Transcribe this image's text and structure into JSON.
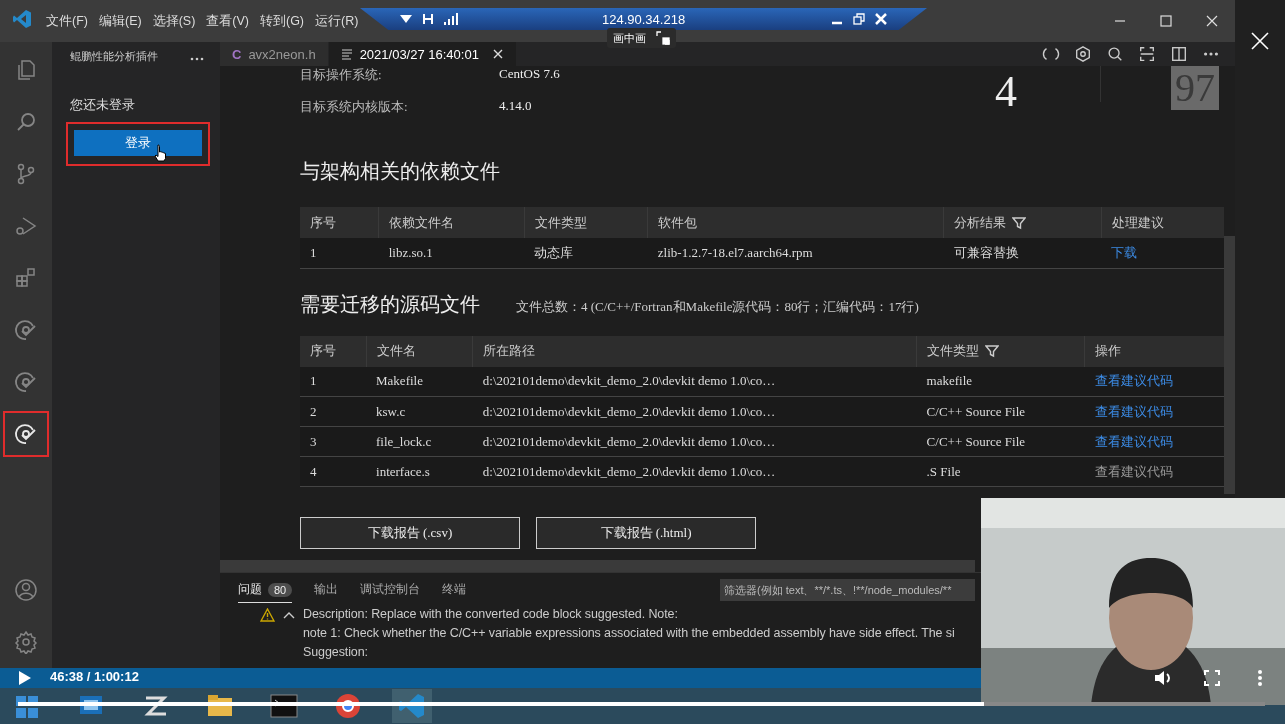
{
  "title_bar": {
    "menu": [
      "文件(F)",
      "编辑(E)",
      "选择(S)",
      "查看(V)",
      "转到(G)",
      "运行(R)"
    ]
  },
  "remote_bar": {
    "address": "124.90.34.218",
    "tooltip": "画中画"
  },
  "activity_bar": {
    "items": [
      {
        "kind": "files",
        "selected": false
      },
      {
        "kind": "search",
        "selected": false
      },
      {
        "kind": "source-control",
        "selected": false
      },
      {
        "kind": "run",
        "selected": false
      },
      {
        "kind": "extensions",
        "selected": false
      },
      {
        "kind": "plugin",
        "selected": false
      },
      {
        "kind": "plugin",
        "selected": false
      },
      {
        "kind": "plugin",
        "selected": true
      }
    ],
    "bottom": [
      {
        "kind": "account"
      },
      {
        "kind": "settings"
      }
    ]
  },
  "sidebar": {
    "title": "鲲鹏性能分析插件",
    "message": "您还未登录",
    "login_button": "登录"
  },
  "tabs": [
    {
      "label": "avx2neon.h",
      "badge": "C",
      "kind": "c-file",
      "selected": false
    },
    {
      "label": "2021/03/27 16:40:01",
      "kind": "preview",
      "selected": true
    }
  ],
  "report": {
    "info": [
      {
        "label": "目标操作系统:",
        "value": "CentOS 7.6"
      },
      {
        "label": "目标系统内核版本:",
        "value": "4.14.0"
      }
    ],
    "stats": [
      {
        "value": "4",
        "kind": "plain"
      },
      {
        "value": "97",
        "kind": "boxed"
      }
    ],
    "dependencies": {
      "heading": "与架构相关的依赖文件",
      "columns": [
        {
          "label": "序号",
          "filter": false
        },
        {
          "label": "依赖文件名",
          "filter": false
        },
        {
          "label": "文件类型",
          "filter": false
        },
        {
          "label": "软件包",
          "filter": false
        },
        {
          "label": "分析结果",
          "filter": true
        },
        {
          "label": "处理建议",
          "filter": false
        }
      ],
      "rows": [
        {
          "cells": [
            "1",
            "libz.so.1",
            "动态库",
            "zlib-1.2.7-18.el7.aarch64.rpm",
            "可兼容替换"
          ],
          "action": {
            "label": "下载",
            "disabled": false
          }
        }
      ]
    },
    "sources": {
      "heading": "需要迁移的源码文件",
      "summary": "文件总数：4 (C/C++/Fortran和Makefile源代码：80行；汇编代码：17行)",
      "columns": [
        {
          "label": "序号",
          "filter": false
        },
        {
          "label": "文件名",
          "filter": false
        },
        {
          "label": "所在路径",
          "filter": false
        },
        {
          "label": "文件类型",
          "filter": true
        },
        {
          "label": "操作",
          "filter": false
        }
      ],
      "rows": [
        {
          "cells": [
            "1",
            "Makefile",
            "d:\\202101demo\\devkit_demo_2.0\\devkit demo 1.0\\co…",
            "makefile"
          ],
          "action": {
            "label": "查看建议代码",
            "disabled": false
          }
        },
        {
          "cells": [
            "2",
            "ksw.c",
            "d:\\202101demo\\devkit_demo_2.0\\devkit demo 1.0\\co…",
            "C/C++ Source File"
          ],
          "action": {
            "label": "查看建议代码",
            "disabled": false
          }
        },
        {
          "cells": [
            "3",
            "file_lock.c",
            "d:\\202101demo\\devkit_demo_2.0\\devkit demo 1.0\\co…",
            "C/C++ Source File"
          ],
          "action": {
            "label": "查看建议代码",
            "disabled": false
          }
        },
        {
          "cells": [
            "4",
            "interface.s",
            "d:\\202101demo\\devkit_demo_2.0\\devkit demo 1.0\\co…",
            ".S File"
          ],
          "action": {
            "label": "查看建议代码",
            "disabled": true
          }
        }
      ]
    },
    "buttons": [
      "下载报告 (.csv)",
      "下载报告 (.html)"
    ]
  },
  "panel": {
    "tabs": [
      {
        "label": "问题",
        "badge": "80",
        "selected": true
      },
      {
        "label": "输出",
        "selected": false
      },
      {
        "label": "调试控制台",
        "selected": false
      },
      {
        "label": "终端",
        "selected": false
      }
    ],
    "filter_placeholder": "筛选器(例如 text、**/*.ts、!**/node_modules/**",
    "problems": [
      {
        "kind": "warning",
        "expanded": true,
        "lines": [
          "Description: Replace with the converted code block suggested. Note:",
          "note 1: Check whether the C/C++ variable expressions associated with the embedded assembly have side effect. The si",
          "Suggestion:"
        ]
      }
    ]
  },
  "video": {
    "time": "46:38 / 1:00:12",
    "level": 0.775
  }
}
